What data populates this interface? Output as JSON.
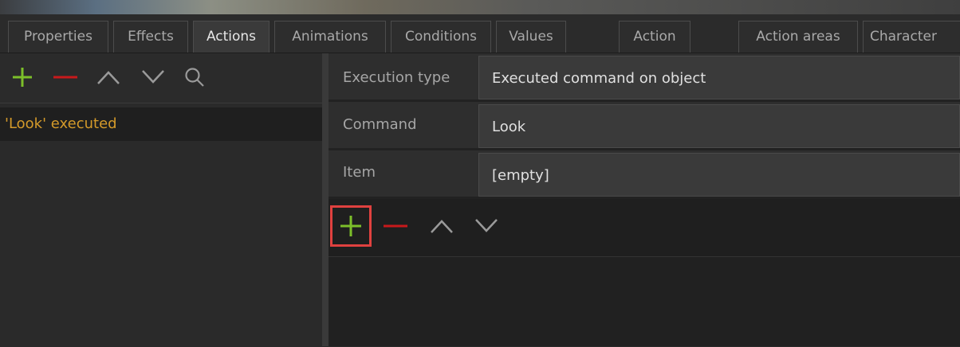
{
  "tabs": [
    {
      "label": "Properties",
      "active": false
    },
    {
      "label": "Effects",
      "active": false
    },
    {
      "label": "Actions",
      "active": true
    },
    {
      "label": "Animations",
      "active": false
    },
    {
      "label": "Conditions",
      "active": false
    },
    {
      "label": "Values",
      "active": false
    },
    {
      "label": "Action",
      "active": false
    },
    {
      "label": "Action areas",
      "active": false
    },
    {
      "label": "Character",
      "active": false
    }
  ],
  "left": {
    "toolbar": [
      "add-icon",
      "remove-icon",
      "move-up-icon",
      "move-down-icon",
      "search-icon"
    ],
    "items": [
      {
        "label": "'Look' executed"
      }
    ]
  },
  "right": {
    "properties": [
      {
        "label": "Execution type",
        "value": "Executed command on object"
      },
      {
        "label": "Command",
        "value": "Look"
      },
      {
        "label": "Item",
        "value": "[empty]"
      }
    ],
    "toolbar": [
      "add-icon",
      "remove-icon",
      "move-up-icon",
      "move-down-icon"
    ]
  },
  "colors": {
    "add": "#7cbf2a",
    "remove": "#c8191b",
    "arrow": "#9a9a9a",
    "selected_item_text": "#d49a2a",
    "highlight": "#e0413f"
  }
}
